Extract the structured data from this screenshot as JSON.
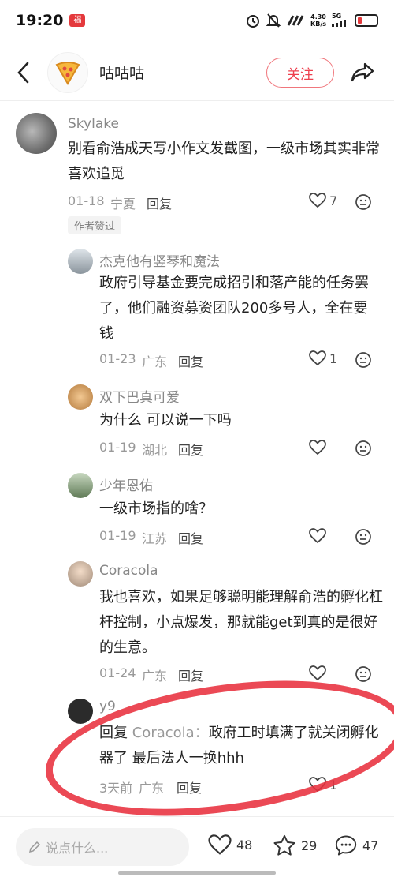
{
  "status": {
    "time": "19:20",
    "speed_top": "4.30",
    "speed_bottom": "KB/s",
    "network": "5G"
  },
  "header": {
    "title": "咕咕咕",
    "follow_label": "关注"
  },
  "comment_main": {
    "name": "Skylake",
    "text": "别看俞浩成天写小作文发截图，一级市场其实非常喜欢追觅",
    "date": "01-18",
    "region": "宁夏",
    "reply_label": "回复",
    "likes": "7",
    "badge": "作者赞过"
  },
  "replies": [
    {
      "name": "杰克他有竖琴和魔法",
      "text": "政府引导基金要完成招引和落产能的任务罢了，他们融资募资团队200多号人，全在要钱",
      "date": "01-23",
      "region": "广东",
      "reply_label": "回复",
      "likes": "1"
    },
    {
      "name": "双下巴真可爱",
      "text": "为什么 可以说一下吗",
      "date": "01-19",
      "region": "湖北",
      "reply_label": "回复",
      "likes": ""
    },
    {
      "name": "少年恩佑",
      "text": "一级市场指的啥？",
      "date": "01-19",
      "region": "江苏",
      "reply_label": "回复",
      "likes": ""
    },
    {
      "name": "Coracola",
      "text": "我也喜欢，如果足够聪明能理解俞浩的孵化杠杆控制，小点爆发，那就能get到真的是很好的生意。",
      "date": "01-24",
      "region": "广东",
      "reply_label": "回复",
      "likes": ""
    },
    {
      "name": "y9",
      "reply_prefix": "回复",
      "reply_to": "Coracola：",
      "text": "政府工时填满了就关闭孵化器了 最后法人一换hhh",
      "date": "3天前",
      "region": "广东",
      "reply_label": "回复",
      "likes": "1"
    }
  ],
  "bottom": {
    "input_placeholder": "说点什么...",
    "likes": "48",
    "stars": "29",
    "comments": "47"
  },
  "colors": {
    "accent": "#ee3f4d",
    "annotation": "#e8303e"
  }
}
